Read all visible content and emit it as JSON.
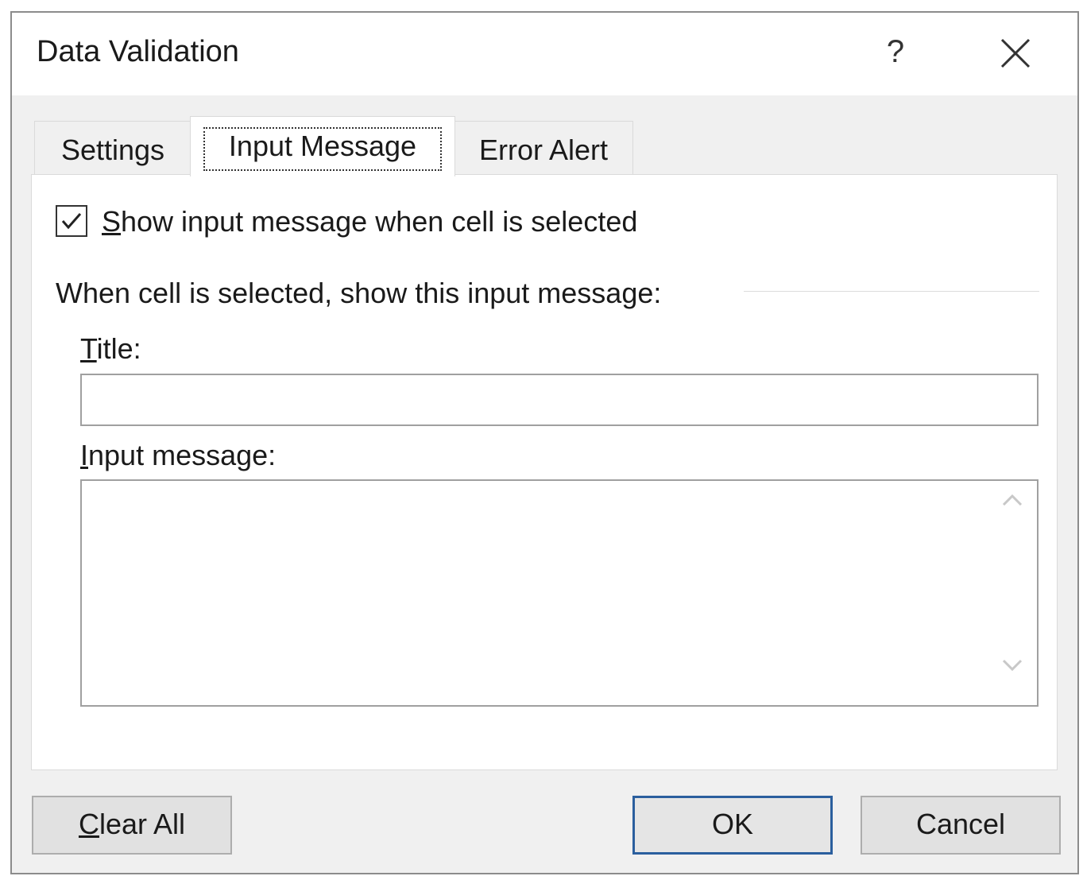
{
  "dialog": {
    "title": "Data Validation",
    "help_glyph": "?",
    "close_glyph": "✕"
  },
  "tabs": [
    {
      "label": "Settings",
      "active": false
    },
    {
      "label": "Input Message",
      "active": true
    },
    {
      "label": "Error Alert",
      "active": false
    }
  ],
  "input_message": {
    "show_checkbox": {
      "label_mnemonic": "S",
      "label_rest": "how input message when cell is selected",
      "checked": true
    },
    "group_heading": "When cell is selected, show this input message:",
    "title_field": {
      "label_mnemonic": "T",
      "label_rest": "itle:",
      "value": ""
    },
    "message_field": {
      "label_mnemonic": "I",
      "label_rest": "nput message:",
      "value": ""
    }
  },
  "buttons": {
    "clear_all_mnemonic": "C",
    "clear_all_rest": "lear All",
    "ok": "OK",
    "cancel": "Cancel"
  },
  "colors": {
    "dialog_bg": "#f0f0f0",
    "panel_bg": "#ffffff",
    "default_button_border": "#2b5f9e"
  },
  "icons": {
    "close": "close-icon",
    "help": "help-icon",
    "checkmark": "checkmark-icon",
    "scroll_up": "chevron-up-icon",
    "scroll_down": "chevron-down-icon"
  }
}
